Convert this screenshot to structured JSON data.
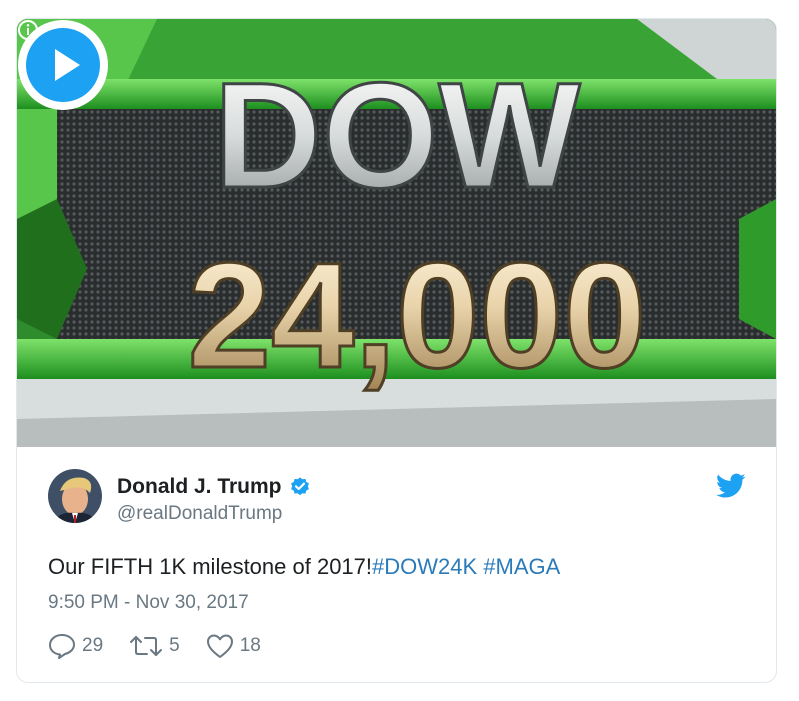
{
  "media": {
    "headline_top": "DOW",
    "headline_bottom": "24,000",
    "icons": {
      "info": "info-icon",
      "play": "play-icon"
    }
  },
  "author": {
    "name": "Donald J. Trump",
    "handle": "@realDonaldTrump",
    "verified": true
  },
  "tweet": {
    "text": "Our FIFTH 1K milestone of 2017!",
    "hashtags": [
      "#DOW24K",
      "#MAGA"
    ],
    "timestamp": "9:50 PM - Nov 30, 2017"
  },
  "actions": {
    "replies": "29",
    "retweets": "5",
    "likes": "18"
  },
  "colors": {
    "link": "#2b7bb9",
    "verified": "#1da1f2",
    "twitter_brand": "#1da1f2",
    "muted": "#697882",
    "play": "#1da1f2"
  }
}
